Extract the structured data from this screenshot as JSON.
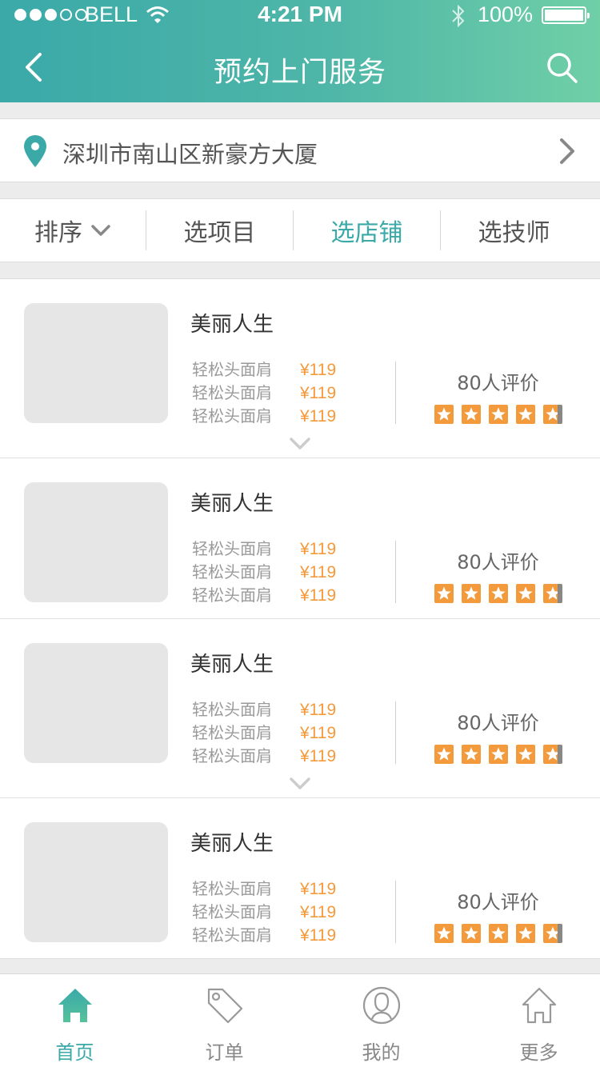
{
  "status_bar": {
    "carrier": "BELL",
    "time": "4:21 PM",
    "battery": "100%",
    "icons": [
      "signal-dots-icon",
      "wifi-icon",
      "bluetooth-icon",
      "battery-icon"
    ]
  },
  "nav": {
    "title": "预约上门服务",
    "back_icon": "chevron-left-icon",
    "search_icon": "search-icon"
  },
  "location": {
    "address": "深圳市南山区新豪方大厦",
    "icon": "location-pin-icon"
  },
  "filters": {
    "tabs": [
      {
        "label": "排序",
        "active": false,
        "has_dropdown": true
      },
      {
        "label": "选项目",
        "active": false
      },
      {
        "label": "选店铺",
        "active": true
      },
      {
        "label": "选技师",
        "active": false
      }
    ]
  },
  "shops": [
    {
      "name": "美丽人生",
      "services": [
        {
          "name": "轻松头面肩",
          "price": "¥119"
        },
        {
          "name": "轻松头面肩",
          "price": "¥119"
        },
        {
          "name": "轻松头面肩",
          "price": "¥119"
        }
      ],
      "reviews": "80人评价",
      "rating": 4.8,
      "expandable": true
    },
    {
      "name": "美丽人生",
      "services": [
        {
          "name": "轻松头面肩",
          "price": "¥119"
        },
        {
          "name": "轻松头面肩",
          "price": "¥119"
        },
        {
          "name": "轻松头面肩",
          "price": "¥119"
        }
      ],
      "reviews": "80人评价",
      "rating": 4.8,
      "expandable": false
    },
    {
      "name": "美丽人生",
      "services": [
        {
          "name": "轻松头面肩",
          "price": "¥119"
        },
        {
          "name": "轻松头面肩",
          "price": "¥119"
        },
        {
          "name": "轻松头面肩",
          "price": "¥119"
        }
      ],
      "reviews": "80人评价",
      "rating": 4.8,
      "expandable": true
    },
    {
      "name": "美丽人生",
      "services": [
        {
          "name": "轻松头面肩",
          "price": "¥119"
        },
        {
          "name": "轻松头面肩",
          "price": "¥119"
        },
        {
          "name": "轻松头面肩",
          "price": "¥119"
        }
      ],
      "reviews": "80人评价",
      "rating": 4.8,
      "expandable": false
    }
  ],
  "tab_bar": {
    "items": [
      {
        "label": "首页",
        "icon": "home-icon",
        "active": true
      },
      {
        "label": "订单",
        "icon": "tag-icon",
        "active": false
      },
      {
        "label": "我的",
        "icon": "profile-icon",
        "active": false
      },
      {
        "label": "更多",
        "icon": "house-outline-icon",
        "active": false
      }
    ]
  },
  "colors": {
    "accent": "#3aa9a8",
    "header_gradient_end": "#6fcfa7",
    "price": "#f39a3d",
    "star": "#f39a3d"
  }
}
